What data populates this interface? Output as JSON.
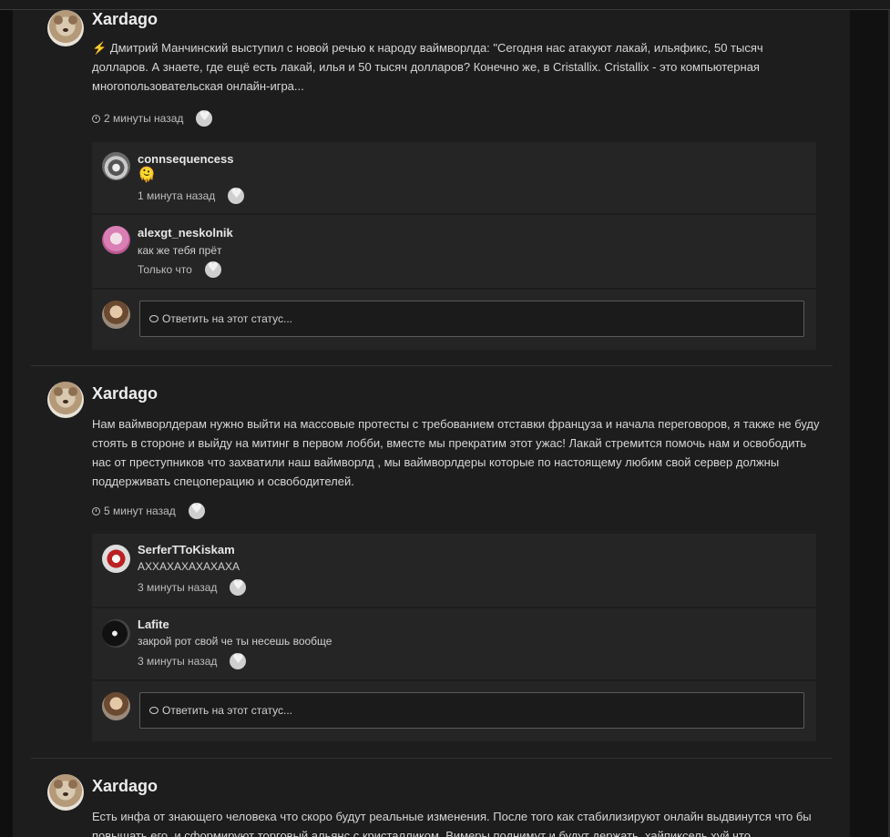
{
  "statuses": [
    {
      "author": "Xardago",
      "emoji": "⚡",
      "text": "Дмитрий Манчинский выступил с новой речью к народу ваймворлда: \"Сегодня нас атакуют лакай, ильяфикс, 50 тысяч долларов. А знаете, где ещё есть лакай, илья и 50 тысяч долларов? Конечно же, в Cristallix. Cristallix - это компьютерная многопользовательская онлайн-игра...",
      "time": "2 минуты назад",
      "comments": [
        {
          "name": "connsequencess",
          "text": "🫠",
          "time": "1 минута назад"
        },
        {
          "name": "alexgt_neskolnik",
          "text": "как же тебя прёт",
          "time": "Только что"
        }
      ],
      "reply_placeholder": "Ответить на этот статус..."
    },
    {
      "author": "Xardago",
      "text": "Нам ваймворлдерам нужно выйти на массовые протесты с требованием отставки француза и начала переговоров, я также не буду стоять в стороне и выйду на митинг в первом лобби, вместе мы прекратим этот ужас! Лакай стремится помочь нам и освободить нас от преступников что захватили наш ваймворлд , мы ваймворлдеры которые по настоящему любим свой сервер должны поддерживать спецоперацию и освободителей.",
      "time": "5 минут назад",
      "comments": [
        {
          "name": "SerferTToKiskam",
          "text": "АХХАХАХАХАХАХА",
          "time": "3 минуты назад"
        },
        {
          "name": "Lafite",
          "text": "закрой рот свой че ты несешь вообще",
          "time": "3 минуты назад"
        }
      ],
      "reply_placeholder": "Ответить на этот статус..."
    },
    {
      "author": "Xardago",
      "text": "Есть инфа от знающего человека что скоро будут реальные изменения. После того как стабилизируют онлайн выдвинутся что бы повышать его, и сформируют торговый альянс с кристалликом. Вимеры поднимут и будут держать, хайпиксель хуй что"
    }
  ]
}
